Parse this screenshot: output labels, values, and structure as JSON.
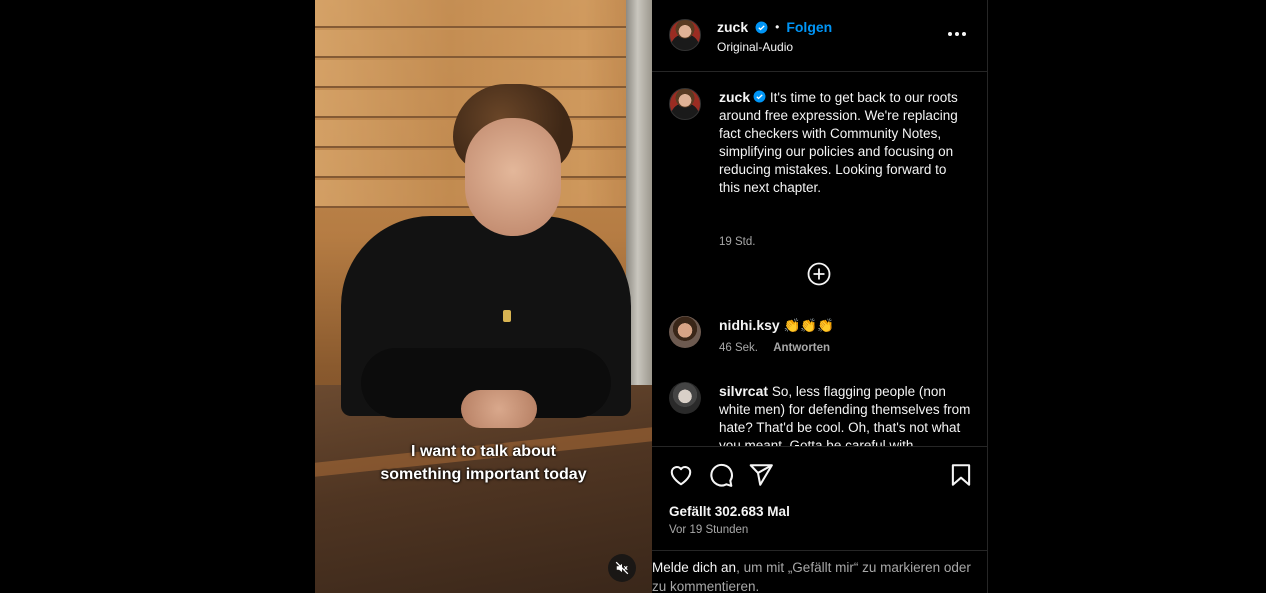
{
  "video": {
    "subtitle_line1": "I want to talk about",
    "subtitle_line2": "something important today",
    "mute_icon": "speaker-muted-icon"
  },
  "header": {
    "username": "zuck",
    "verified_icon": "verified-badge-icon",
    "separator": "•",
    "follow_label": "Folgen",
    "audio_label": "Original-Audio",
    "more_icon": "more-options-icon"
  },
  "post_caption": {
    "username": "zuck",
    "text": "It's time to get back to our roots around free expression. We're replacing fact checkers with Community Notes, simplifying our policies and focusing on reducing mistakes. Looking forward to this next chapter.",
    "time": "19 Std."
  },
  "load_more_icon": "plus-circle-icon",
  "comments": [
    {
      "username": "nidhi.ksy",
      "text": "👏👏👏",
      "time": "46 Sek.",
      "reply_label": "Antworten"
    },
    {
      "username": "silvrcat",
      "text": "So, less flagging people (non white men) for defending themselves from hate? That'd be cool. Oh, that's not what you meant. Gotta be careful with"
    }
  ],
  "actions": {
    "like_icon": "heart-icon",
    "comment_icon": "comment-icon",
    "share_icon": "share-icon",
    "save_icon": "bookmark-icon",
    "likes_text": "Gefällt 302.683 Mal",
    "post_time": "Vor 19 Stunden"
  },
  "login_prompt": {
    "link_text": "Melde dich an",
    "rest_text": ", um mit „Gefällt mir“ zu markieren oder zu kommentieren."
  },
  "colors": {
    "background": "#000000",
    "text": "#f5f5f5",
    "muted_text": "#a8a8a8",
    "accent_blue": "#0095f6",
    "divider": "#262626"
  }
}
